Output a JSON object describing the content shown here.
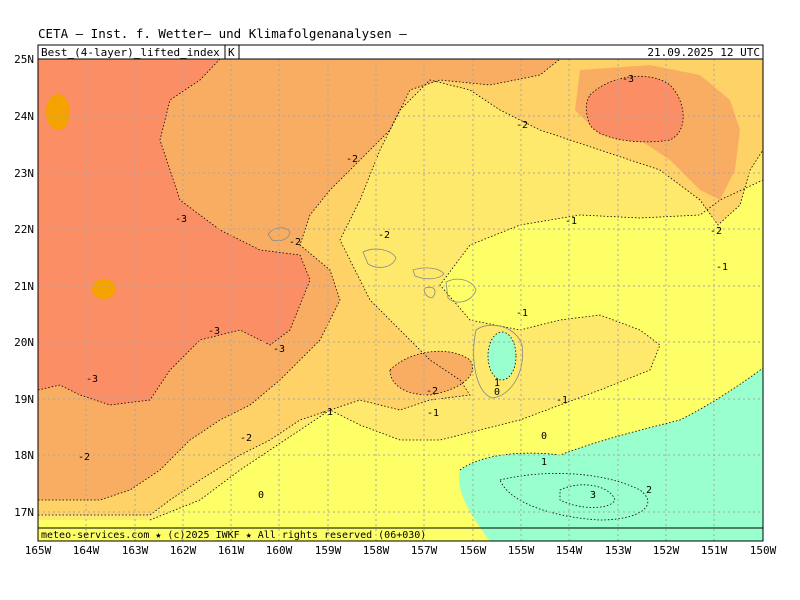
{
  "header": {
    "title": "CETA — Inst. f. Wetter— und Klimafolgenanalysen —",
    "field_label": "Best_(4-layer)_lifted_index",
    "unit": "K",
    "valid_time": "21.09.2025 12 UTC"
  },
  "footer": {
    "credit": "meteo-services.com ★ (c)2025 IWKF ★ All rights reserved (06+030)"
  },
  "axes": {
    "lat_ticks": [
      "25N",
      "24N",
      "23N",
      "22N",
      "21N",
      "20N",
      "19N",
      "18N",
      "17N"
    ],
    "lon_ticks": [
      "165W",
      "164W",
      "163W",
      "162W",
      "161W",
      "160W",
      "159W",
      "158W",
      "157W",
      "156W",
      "155W",
      "154W",
      "153W",
      "152W",
      "151W",
      "150W"
    ]
  },
  "palette": {
    "lt_minus4": "#f3a200",
    "lt_minus3": "#fc8e66",
    "lt_minus2": "#f9ad63",
    "lt_minus1": "#fed266",
    "lt_0": "#fee96c",
    "lt_1": "#fefe66",
    "gt_1": "#99ffcc",
    "grid": "#a8a8a8"
  },
  "contour_labels": [
    {
      "text": "-3",
      "pos": "upper-right"
    },
    {
      "text": "-2",
      "pos": "upper-center"
    },
    {
      "text": "-2",
      "pos": "upper-left-center"
    },
    {
      "text": "-2",
      "pos": "center-left"
    },
    {
      "text": "-2",
      "pos": "center"
    },
    {
      "text": "-2",
      "pos": "right"
    },
    {
      "text": "-3",
      "pos": "left"
    },
    {
      "text": "-1",
      "pos": "upper-right-center"
    },
    {
      "text": "-1",
      "pos": "right"
    },
    {
      "text": "-1",
      "pos": "center-right"
    },
    {
      "text": "-3",
      "pos": "left-center"
    },
    {
      "text": "-3",
      "pos": "left-lower"
    },
    {
      "text": "-3",
      "pos": "left-bottom"
    },
    {
      "text": "-2",
      "pos": "lower-left"
    },
    {
      "text": "-2",
      "pos": "bottom-left"
    },
    {
      "text": "-1",
      "pos": "lower-center"
    },
    {
      "text": "-1",
      "pos": "lower-center"
    },
    {
      "text": "-1",
      "pos": "lower-right"
    },
    {
      "text": "-2",
      "pos": "center-lower"
    },
    {
      "text": "1",
      "pos": "center"
    },
    {
      "text": "0",
      "pos": "center"
    },
    {
      "text": "0",
      "pos": "lower-center"
    },
    {
      "text": "0",
      "pos": "lower-left"
    },
    {
      "text": "1",
      "pos": "lower-center"
    },
    {
      "text": "3",
      "pos": "lower-right"
    },
    {
      "text": "2",
      "pos": "lower-right"
    }
  ]
}
